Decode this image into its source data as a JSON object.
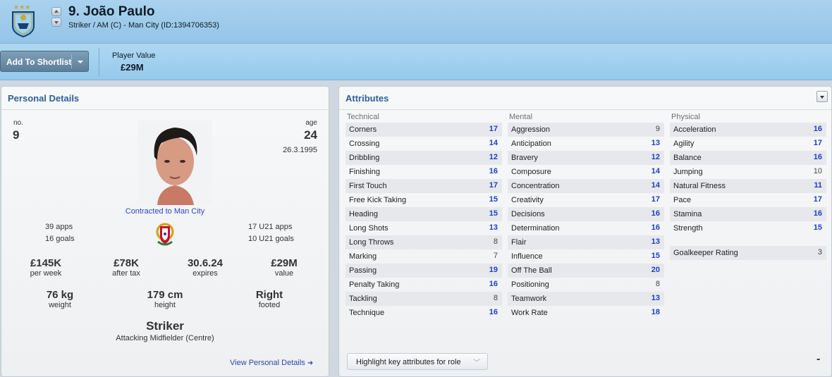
{
  "header": {
    "player_name": "9. João Paulo",
    "player_sub": "Striker / AM (C) - Man City (ID:1394706353)"
  },
  "toolbar": {
    "shortlist_label": "Add To Shortlist",
    "player_value_label": "Player Value",
    "player_value": "£29M"
  },
  "personal": {
    "title": "Personal Details",
    "no_label": "no.",
    "no": "9",
    "age_label": "age",
    "age": "24",
    "dob": "26.3.1995",
    "contract": "Contracted to Man City",
    "apps": "39 apps",
    "goals": "16 goals",
    "u21_apps": "17 U21 apps",
    "u21_goals": "10 U21 goals",
    "wage": "£145K",
    "wage_label": "per week",
    "after_tax": "£78K",
    "after_tax_label": "after tax",
    "expires": "30.6.24",
    "expires_label": "expires",
    "value": "£29M",
    "value_label": "value",
    "weight": "76 kg",
    "weight_label": "weight",
    "height": "179 cm",
    "height_label": "height",
    "foot": "Right",
    "foot_label": "footed",
    "role_main": "Striker",
    "role_sub": "Attacking Midfielder (Centre)",
    "view_link": "View Personal Details"
  },
  "attributes": {
    "title": "Attributes",
    "technical_title": "Technical",
    "mental_title": "Mental",
    "physical_title": "Physical",
    "technical": [
      {
        "name": "Corners",
        "value": "17"
      },
      {
        "name": "Crossing",
        "value": "14"
      },
      {
        "name": "Dribbling",
        "value": "12"
      },
      {
        "name": "Finishing",
        "value": "16"
      },
      {
        "name": "First Touch",
        "value": "17"
      },
      {
        "name": "Free Kick Taking",
        "value": "15"
      },
      {
        "name": "Heading",
        "value": "15"
      },
      {
        "name": "Long Shots",
        "value": "13"
      },
      {
        "name": "Long Throws",
        "value": "8"
      },
      {
        "name": "Marking",
        "value": "7"
      },
      {
        "name": "Passing",
        "value": "19"
      },
      {
        "name": "Penalty Taking",
        "value": "16"
      },
      {
        "name": "Tackling",
        "value": "8"
      },
      {
        "name": "Technique",
        "value": "16"
      }
    ],
    "mental": [
      {
        "name": "Aggression",
        "value": "9"
      },
      {
        "name": "Anticipation",
        "value": "13"
      },
      {
        "name": "Bravery",
        "value": "12"
      },
      {
        "name": "Composure",
        "value": "14"
      },
      {
        "name": "Concentration",
        "value": "14"
      },
      {
        "name": "Creativity",
        "value": "17"
      },
      {
        "name": "Decisions",
        "value": "16"
      },
      {
        "name": "Determination",
        "value": "16"
      },
      {
        "name": "Flair",
        "value": "13"
      },
      {
        "name": "Influence",
        "value": "15"
      },
      {
        "name": "Off The Ball",
        "value": "20"
      },
      {
        "name": "Positioning",
        "value": "8"
      },
      {
        "name": "Teamwork",
        "value": "13"
      },
      {
        "name": "Work Rate",
        "value": "18"
      }
    ],
    "physical": [
      {
        "name": "Acceleration",
        "value": "16"
      },
      {
        "name": "Agility",
        "value": "17"
      },
      {
        "name": "Balance",
        "value": "16"
      },
      {
        "name": "Jumping",
        "value": "10"
      },
      {
        "name": "Natural Fitness",
        "value": "11"
      },
      {
        "name": "Pace",
        "value": "17"
      },
      {
        "name": "Stamina",
        "value": "16"
      },
      {
        "name": "Strength",
        "value": "15"
      }
    ],
    "gk_label": "Goalkeeper Rating",
    "gk_value": "3",
    "highlight_select": "Highlight key attributes for role",
    "minus": "-"
  }
}
